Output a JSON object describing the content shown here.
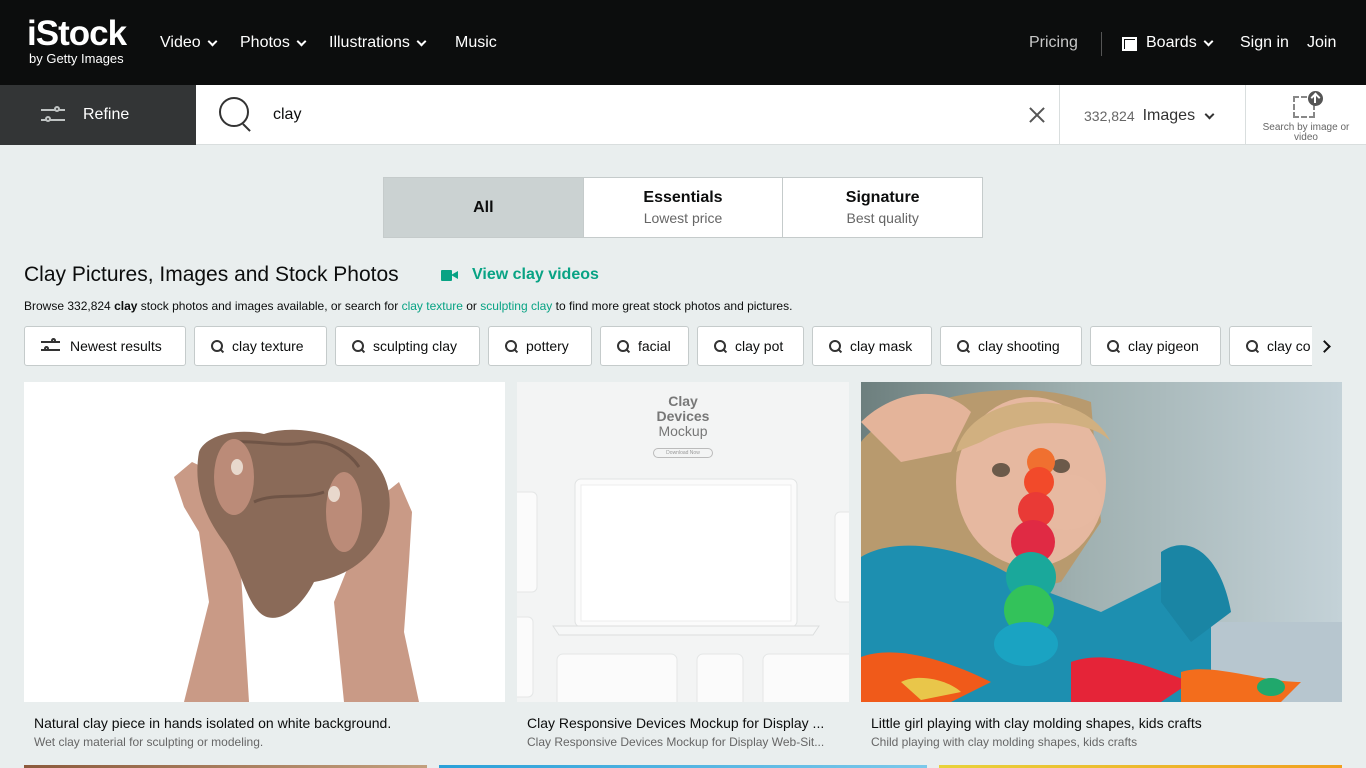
{
  "brand": {
    "name": "iStock",
    "tagline": "by Getty Images"
  },
  "nav": {
    "items": [
      {
        "label": "Video"
      },
      {
        "label": "Photos"
      },
      {
        "label": "Illustrations"
      },
      {
        "label": "Music"
      }
    ],
    "pricing": "Pricing",
    "boards": "Boards",
    "signin": "Sign in",
    "join": "Join"
  },
  "search": {
    "refine": "Refine",
    "query": "clay",
    "count": "332,824",
    "type": "Images",
    "search_by_image": "Search by image or video"
  },
  "tabs": [
    {
      "title": "All",
      "subtitle": ""
    },
    {
      "title": "Essentials",
      "subtitle": "Lowest price"
    },
    {
      "title": "Signature",
      "subtitle": "Best quality"
    }
  ],
  "heading": {
    "title": "Clay Pictures, Images and Stock Photos",
    "videos_link": "View clay videos",
    "browse": {
      "prefix": "Browse 332,824 ",
      "bold": "clay",
      "mid1": " stock photos and images available, or search for ",
      "link1": "clay texture",
      "mid2": " or ",
      "link2": "sculpting clay",
      "suffix": " to find more great stock photos and pictures."
    }
  },
  "chips": {
    "filter": "Newest results",
    "items": [
      "clay texture",
      "sculpting clay",
      "pottery",
      "facial",
      "clay pot",
      "clay mask",
      "clay shooting",
      "clay pigeon",
      "clay co"
    ]
  },
  "results": [
    {
      "title": "Natural clay piece in hands isolated on white background.",
      "subtitle": "Wet clay material for sculpting or modeling."
    },
    {
      "title": "Clay Responsive Devices Mockup for Display ...",
      "subtitle": "Clay Responsive Devices Mockup for Display Web-Sit...",
      "mock": {
        "line1": "Clay",
        "line2": "Devices",
        "line3": "Mockup",
        "button": "Download Now"
      }
    },
    {
      "title": "Little girl playing with clay molding shapes, kids crafts",
      "subtitle": "Child playing with clay molding shapes, kids crafts"
    }
  ],
  "colors": {
    "accent": "#08a384",
    "topbar": "#0c0d0d",
    "refine_bg": "#333536",
    "page_bg": "#e9eeee"
  }
}
